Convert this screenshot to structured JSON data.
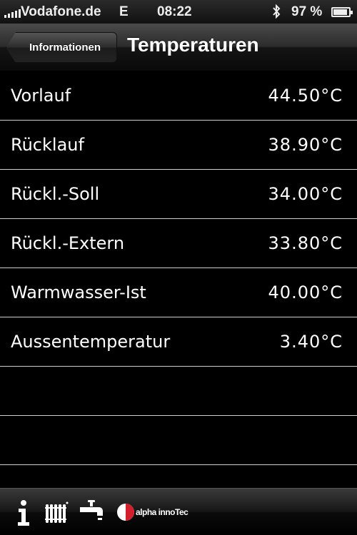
{
  "status_bar": {
    "carrier": "Vodafone.de",
    "network": "E",
    "time": "08:22",
    "battery_percent": "97 %",
    "battery_level": 0.97,
    "icons": [
      "signal-icon",
      "bluetooth-icon",
      "battery-icon"
    ]
  },
  "nav_bar": {
    "back_label": "Informationen",
    "title": "Temperaturen"
  },
  "temperatures": [
    {
      "label": "Vorlauf",
      "value": "44.50°C"
    },
    {
      "label": "Rücklauf",
      "value": "38.90°C"
    },
    {
      "label": "Rückl.-Soll",
      "value": "34.00°C"
    },
    {
      "label": "Rückl.-Extern",
      "value": "33.80°C"
    },
    {
      "label": "Warmwasser-Ist",
      "value": "40.00°C"
    },
    {
      "label": "Aussentemperatur",
      "value": "3.40°C"
    }
  ],
  "tab_bar": {
    "icons": [
      "info-icon",
      "radiator-icon",
      "water-tap-icon"
    ],
    "logo_text": "alpha innoTec"
  },
  "colors": {
    "background": "#000000",
    "text": "#ffffff",
    "separator": "#cfcfcf",
    "logo_red": "#d21f2b"
  }
}
